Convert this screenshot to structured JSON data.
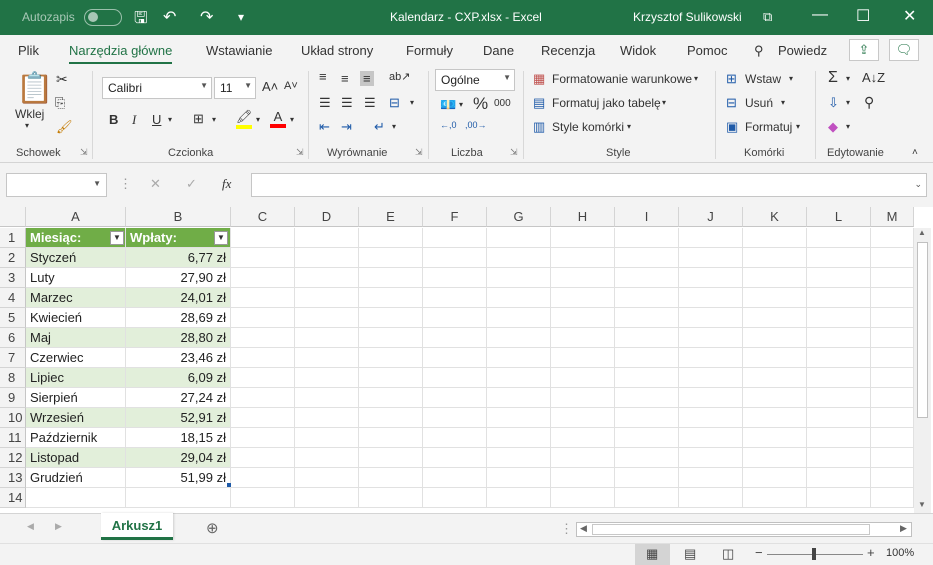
{
  "titlebar": {
    "autosave_label": "Autozapis",
    "title": "Kalendarz - CXP.xlsx  -  Excel",
    "user": "Krzysztof Sulikowski"
  },
  "tabs": [
    "Plik",
    "Narzędzia główne",
    "Wstawianie",
    "Układ strony",
    "Formuły",
    "Dane",
    "Recenzja",
    "Widok",
    "Pomoc",
    "Powiedz"
  ],
  "ribbon": {
    "paste_label": "Wklej",
    "font_name": "Calibri",
    "font_size": "11",
    "number_format": "Ogólne",
    "conditional_formatting": "Formatowanie warunkowe",
    "format_as_table": "Formatuj jako tabelę",
    "cell_styles": "Style komórki",
    "insert": "Wstaw",
    "delete": "Usuń",
    "format": "Formatuj",
    "groups": [
      "Schowek",
      "Czcionka",
      "Wyrównanie",
      "Liczba",
      "Style",
      "Komórki",
      "Edytowanie"
    ]
  },
  "formula_bar": {
    "namebox": "",
    "fx": "fx",
    "value": ""
  },
  "columns": [
    "A",
    "B",
    "C",
    "D",
    "E",
    "F",
    "G",
    "H",
    "I",
    "J",
    "K",
    "L",
    "M"
  ],
  "rows": [
    "1",
    "2",
    "3",
    "4",
    "5",
    "6",
    "7",
    "8",
    "9",
    "10",
    "11",
    "12",
    "13",
    "14"
  ],
  "table": {
    "headers": [
      "Miesiąc:",
      "Wpłaty:"
    ],
    "data": [
      [
        "Styczeń",
        "6,77 zł"
      ],
      [
        "Luty",
        "27,90 zł"
      ],
      [
        "Marzec",
        "24,01 zł"
      ],
      [
        "Kwiecień",
        "28,69 zł"
      ],
      [
        "Maj",
        "28,80 zł"
      ],
      [
        "Czerwiec",
        "23,46 zł"
      ],
      [
        "Lipiec",
        "6,09 zł"
      ],
      [
        "Sierpień",
        "27,24 zł"
      ],
      [
        "Wrzesień",
        "52,91 zł"
      ],
      [
        "Październik",
        "18,15 zł"
      ],
      [
        "Listopad",
        "29,04 zł"
      ],
      [
        "Grudzień",
        "51,99 zł"
      ]
    ]
  },
  "sheet_tab": "Arkusz1",
  "status": {
    "zoom": "100%"
  },
  "colors": {
    "accent": "#217346",
    "table_header": "#70ad47",
    "band": "#e2efda"
  }
}
